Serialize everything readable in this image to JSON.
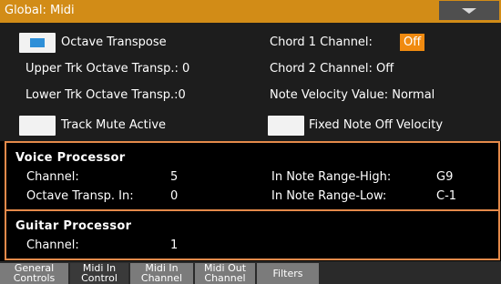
{
  "header": {
    "title": "Global: Midi",
    "menu_icon": "chevron-down-icon"
  },
  "main": {
    "octave_transpose": {
      "label": "Octave Transpose",
      "checked": true
    },
    "upper_trk": {
      "label": "Upper Trk Octave Transp.: 0"
    },
    "lower_trk": {
      "label": "Lower Trk Octave Transp.:0"
    },
    "track_mute": {
      "label": "Track Mute Active",
      "checked": false
    },
    "chord1": {
      "label": "Chord 1 Channel:",
      "value": "Off"
    },
    "chord2": {
      "label": "Chord 2 Channel: Off"
    },
    "velocity": {
      "label": "Note Velocity Value: Normal"
    },
    "fixed_off": {
      "label": "Fixed Note Off Velocity",
      "checked": false
    }
  },
  "voice": {
    "title": "Voice Processor",
    "channel_label": "Channel:",
    "channel_value": "5",
    "octave_label": "Octave Transp. In:",
    "octave_value": "0",
    "high_label": "In Note Range-High:",
    "high_value": "G9",
    "low_label": "In Note Range-Low:",
    "low_value": "C-1"
  },
  "guitar": {
    "title": "Guitar Processor",
    "channel_label": "Channel:",
    "channel_value": "1"
  },
  "tabs": [
    {
      "line1": "General",
      "line2": "Controls"
    },
    {
      "line1": "Midi In",
      "line2": "Control"
    },
    {
      "line1": "Midi In",
      "line2": "Channel"
    },
    {
      "line1": "Midi Out",
      "line2": "Channel"
    },
    {
      "line1": "Filters",
      "line2": ""
    }
  ],
  "colors": {
    "title_bar": "#d28c17",
    "panel_border": "#e58a4a",
    "value_box": "#f08a10",
    "check_mark": "#2e8fd8"
  }
}
